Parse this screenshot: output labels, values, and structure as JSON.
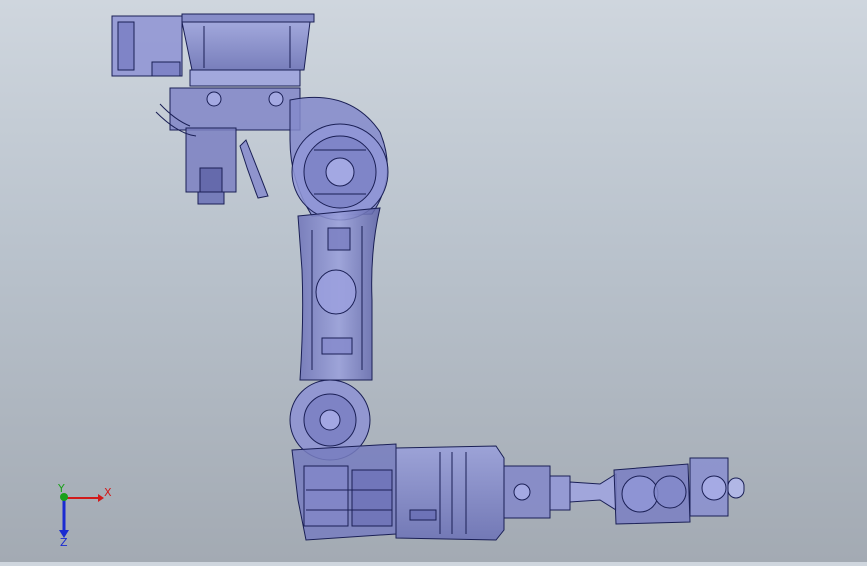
{
  "viewport": {
    "background_top": "#cfd6de",
    "background_bottom": "#a3aab3",
    "model_fill": "#8a8fcf",
    "model_line": "#1a1f55"
  },
  "triad": {
    "x_label": "X",
    "y_label": "Y",
    "z_label": "Z",
    "x_color": "#d11a1a",
    "y_color": "#1aa01a",
    "z_color": "#1a2bd1"
  }
}
